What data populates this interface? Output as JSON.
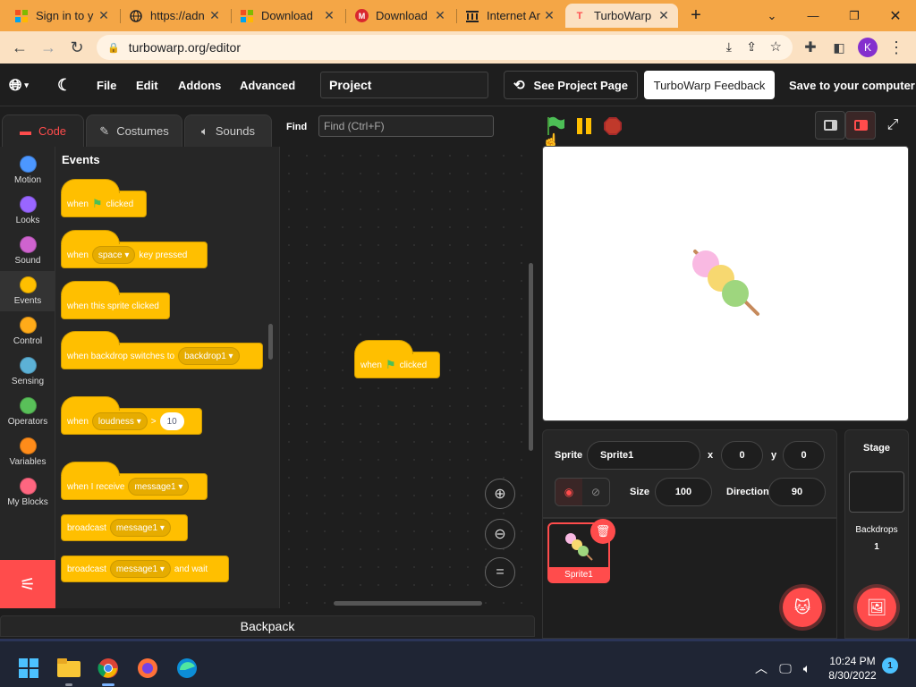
{
  "browser": {
    "tabs": [
      {
        "title": "Sign in to y",
        "icon": "microsoft-icon"
      },
      {
        "title": "https://adn",
        "icon": "globe-icon"
      },
      {
        "title": "Download",
        "icon": "microsoft-icon"
      },
      {
        "title": "Download",
        "icon": "mega-icon"
      },
      {
        "title": "Internet Ar",
        "icon": "archive-icon"
      },
      {
        "title": "TurboWarp",
        "icon": "turbowarp-icon",
        "active": true
      }
    ],
    "url": "turbowarp.org/editor",
    "profile_initial": "K"
  },
  "menubar": {
    "file": "File",
    "edit": "Edit",
    "addons": "Addons",
    "advanced": "Advanced",
    "project_title": "Project",
    "see_project_page": "See Project Page",
    "feedback": "TurboWarp Feedback",
    "save": "Save to your computer"
  },
  "editor_tabs": {
    "code": "Code",
    "costumes": "Costumes",
    "sounds": "Sounds",
    "find_label": "Find",
    "find_placeholder": "Find (Ctrl+F)"
  },
  "categories": [
    {
      "label": "Motion",
      "color": "#4c97ff"
    },
    {
      "label": "Looks",
      "color": "#9966ff"
    },
    {
      "label": "Sound",
      "color": "#cf63cf"
    },
    {
      "label": "Events",
      "color": "#ffbf00"
    },
    {
      "label": "Control",
      "color": "#ffab19"
    },
    {
      "label": "Sensing",
      "color": "#5cb1d6"
    },
    {
      "label": "Operators",
      "color": "#59c059"
    },
    {
      "label": "Variables",
      "color": "#ff8c1a"
    },
    {
      "label": "My Blocks",
      "color": "#ff6680"
    }
  ],
  "flyout": {
    "heading": "Events",
    "when": "when",
    "clicked": "clicked",
    "key_space": "space",
    "key_pressed": "key pressed",
    "sprite_clicked": "when this sprite clicked",
    "backdrop_switches": "when backdrop switches to",
    "backdrop1": "backdrop1",
    "loudness": "loudness",
    "gt": ">",
    "ten": "10",
    "receive": "when I receive",
    "message1": "message1",
    "broadcast": "broadcast",
    "and_wait": "and wait"
  },
  "script_block": {
    "when": "when",
    "clicked": "clicked"
  },
  "backpack": "Backpack",
  "sprite_info": {
    "sprite_label": "Sprite",
    "sprite_name": "Sprite1",
    "x_label": "x",
    "x": "0",
    "y_label": "y",
    "y": "0",
    "size_label": "Size",
    "size": "100",
    "direction_label": "Direction",
    "direction": "90"
  },
  "sprite_list": [
    {
      "name": "Sprite1"
    }
  ],
  "stage_panel": {
    "title": "Stage",
    "backdrops_label": "Backdrops",
    "backdrops_count": "1"
  },
  "clock": {
    "time": "10:24 PM",
    "date": "8/30/2022",
    "notifications": "1"
  },
  "colors": {
    "accent": "#ff4c4c",
    "events": "#ffbf00",
    "chrome": "#f4a646"
  }
}
